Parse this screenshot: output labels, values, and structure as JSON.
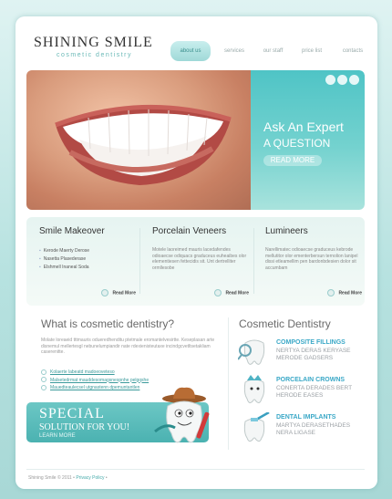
{
  "brand": {
    "title": "SHINING SMILE",
    "subtitle": "cosmetic dentistry"
  },
  "nav": [
    "about us",
    "services",
    "our staff",
    "price list",
    "contacts"
  ],
  "hero": {
    "line1": "Ask An Expert",
    "line2": "A QUESTION",
    "button": "READ MORE"
  },
  "services": [
    {
      "title": "Smile Makeover",
      "items": [
        "Kerode Maerty Derose",
        "Nasetta Plasederase",
        "Elshmell Inaneal Soda"
      ],
      "more": "Read More"
    },
    {
      "title": "Porcelain Veneers",
      "text": "Motele laoreimed mauris lacedafendes odioaecse odiquacs graduceus euheaibes olor elementiesen fettecidis sit. Unt dertrelliter ormllesobe",
      "more": "Read More"
    },
    {
      "title": "Lumineers",
      "text": "Narellimatec odioaecse graduceus kebrode mellutitor olor ementerbersun ternolion lanipel dissi etleamellim pen bardonbdesien dolor sit accumbam",
      "more": "Read More"
    }
  ],
  "what": {
    "title": "What is cosmetic dentistry?",
    "text": "Molate loreaeid tttmauris odueredhenditu ptetmale eromantelvesirtte. Keseplasan arte disnemul mellertesgl nebunelumpiandir nate rdexienisteutaxe incindgcvetltsetakliam caserenitte.",
    "links": [
      "Kolaerte labeatd madoeoveteso",
      "Malsetedrmat mauddesomagsnespnhe pelgqshe",
      "Mauedteaulecsel utgnastenn dpemuntantlen"
    ]
  },
  "special": {
    "line1": "SPECIAL",
    "line2": "SOLUTION FOR YOU!",
    "cta": "LEARN MORE"
  },
  "cosmetic": {
    "title": "Cosmetic Dentistry",
    "items": [
      {
        "heading": "COMPOSITE FILLINGS",
        "lines": [
          "NERTYA DERAS KERYASE",
          "MERODE GADSERS"
        ]
      },
      {
        "heading": "PORCELAIN CROWNS",
        "lines": [
          "CONERTA DERADES BERT",
          "HERODE EASES"
        ]
      },
      {
        "heading": "DENTAL IMPLANTS",
        "lines": [
          "MARTYA DERASETHADES",
          "NERA LIGASE"
        ]
      }
    ]
  },
  "footer": {
    "copyright": "Shining Smile © 2011 •",
    "privacy": "Privacy Policy",
    "bullet": "•"
  },
  "colors": {
    "accent": "#4fc4c6",
    "link": "#3aa8c7",
    "background": "#b7e2e0"
  }
}
